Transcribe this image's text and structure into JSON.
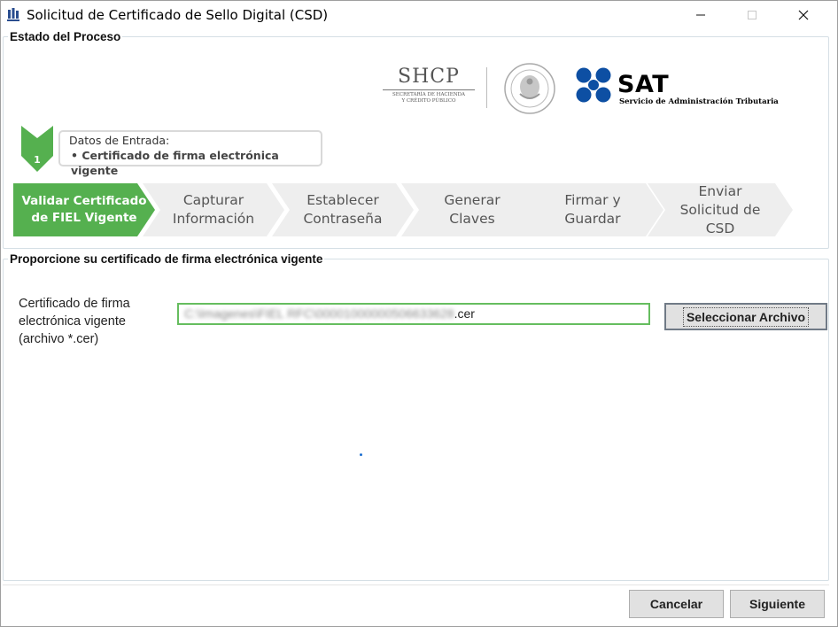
{
  "window": {
    "title": "Solicitud de Certificado de Sello Digital (CSD)",
    "controls": [
      "minimize",
      "maximize",
      "close"
    ]
  },
  "process_group": {
    "legend": "Estado del Proceso",
    "logos": {
      "shcp_word": "SHCP",
      "shcp_sub_line1": "SECRETARÍA DE HACIENDA",
      "shcp_sub_line2": "Y CRÉDITO PÚBLICO",
      "sat_word": "SAT",
      "sat_sub": "Servicio de Administración Tributaria"
    },
    "current_step": {
      "number": "1",
      "title": "Datos de Entrada:",
      "item": "•   Certificado de firma electrónica vigente"
    },
    "steps": [
      {
        "line1": "Validar Certificado",
        "line2": "de FIEL Vigente",
        "line3": "",
        "active": true
      },
      {
        "line1": "Capturar",
        "line2": "Información",
        "line3": "",
        "active": false
      },
      {
        "line1": "Establecer",
        "line2": "Contraseña",
        "line3": "",
        "active": false
      },
      {
        "line1": "Generar",
        "line2": "Claves",
        "line3": "",
        "active": false
      },
      {
        "line1": "Firmar y",
        "line2": "Guardar",
        "line3": "",
        "active": false
      },
      {
        "line1": "Enviar",
        "line2": "Solicitud de",
        "line3": "CSD",
        "active": false
      }
    ],
    "colors": {
      "active": "#55b04f",
      "inactive": "#eeeeee"
    }
  },
  "form_group": {
    "legend": "Proporcione su certificado de firma electrónica vigente",
    "field_label_line1": "Certificado de firma",
    "field_label_line2": "electrónica vigente",
    "field_label_line3": "(archivo *.cer)",
    "file_path_blurred": "C:\\Imagenes\\FIEL RFC\\00001000000506633628",
    "file_path_ext": ".cer",
    "select_button": "Seleccionar Archivo"
  },
  "footer": {
    "cancel_label": "Cancelar",
    "next_label": "Siguiente"
  }
}
